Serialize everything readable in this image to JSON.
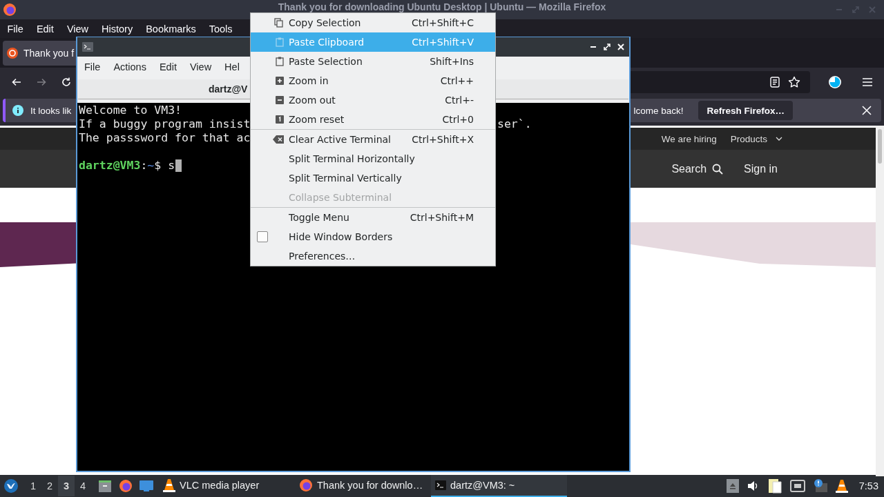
{
  "firefox": {
    "title": "Thank you for downloading Ubuntu Desktop | Ubuntu — Mozilla Firefox",
    "menu": [
      "File",
      "Edit",
      "View",
      "History",
      "Bookmarks",
      "Tools"
    ],
    "tab": {
      "title": "Thank you f",
      "selected": true
    },
    "nav_buttons": [
      {
        "kind": "back",
        "disabled": false
      },
      {
        "kind": "forward",
        "disabled": true
      },
      {
        "kind": "reload",
        "disabled": false
      }
    ],
    "notification": {
      "text_start": "It looks lik",
      "text_end": "lcome back!",
      "button": "Refresh Firefox…"
    },
    "page": {
      "nav_links": [
        "We are hiring",
        "Products"
      ],
      "search": "Search",
      "sign_in": "Sign in"
    }
  },
  "terminal": {
    "menu": [
      "File",
      "Actions",
      "Edit",
      "View",
      "Hel"
    ],
    "tab_title": "dartz@V",
    "lines": [
      {
        "text": "Welcome to VM3!"
      },
      {
        "text": "If a buggy program insist",
        "text_right": "ser`."
      },
      {
        "text": "The passsword for that ac"
      }
    ],
    "prompt": {
      "user": "dartz@VM3",
      "sep": ":",
      "path": "~",
      "symbol": "$",
      "input": "s"
    }
  },
  "context_menu": {
    "items": [
      {
        "kind": "action",
        "label": "Copy Selection",
        "shortcut": "Ctrl+Shift+C",
        "selected": false,
        "disabled": false
      },
      {
        "kind": "action",
        "label": "Paste Clipboard",
        "shortcut": "Ctrl+Shift+V",
        "selected": true,
        "disabled": false
      },
      {
        "kind": "action",
        "label": "Paste Selection",
        "shortcut": "Shift+Ins",
        "selected": false,
        "disabled": false
      },
      {
        "kind": "action",
        "label": "Zoom in",
        "shortcut": "Ctrl++",
        "selected": false,
        "disabled": false
      },
      {
        "kind": "action",
        "label": "Zoom out",
        "shortcut": "Ctrl+-",
        "selected": false,
        "disabled": false
      },
      {
        "kind": "action",
        "label": "Zoom reset",
        "shortcut": "Ctrl+0",
        "selected": false,
        "disabled": false
      },
      {
        "kind": "separator"
      },
      {
        "kind": "action",
        "label": "Clear Active Terminal",
        "shortcut": "Ctrl+Shift+X",
        "selected": false,
        "disabled": false
      },
      {
        "kind": "action",
        "label": "Split Terminal Horizontally",
        "selected": false,
        "disabled": false
      },
      {
        "kind": "action",
        "label": "Split Terminal Vertically",
        "selected": false,
        "disabled": false
      },
      {
        "kind": "action",
        "label": "Collapse Subterminal",
        "selected": false,
        "disabled": true
      },
      {
        "kind": "separator"
      },
      {
        "kind": "action",
        "label": "Toggle Menu",
        "shortcut": "Ctrl+Shift+M",
        "selected": false,
        "disabled": false
      },
      {
        "kind": "check",
        "label": "Hide Window Borders",
        "checked": false,
        "selected": false,
        "disabled": false
      },
      {
        "kind": "action",
        "label": "Preferences…",
        "selected": false,
        "disabled": false
      }
    ]
  },
  "taskbar": {
    "workspaces": [
      {
        "label": "1",
        "selected": false
      },
      {
        "label": "2",
        "selected": false
      },
      {
        "label": "3",
        "selected": true
      },
      {
        "label": "4",
        "selected": false
      }
    ],
    "tasks": [
      {
        "kind": "vlc",
        "label": "VLC media player",
        "selected": false
      },
      {
        "kind": "firefox",
        "label": "Thank you for downlo…",
        "selected": false
      },
      {
        "kind": "terminal",
        "label": "dartz@VM3: ~",
        "selected": true
      }
    ],
    "clock": "7:53"
  }
}
